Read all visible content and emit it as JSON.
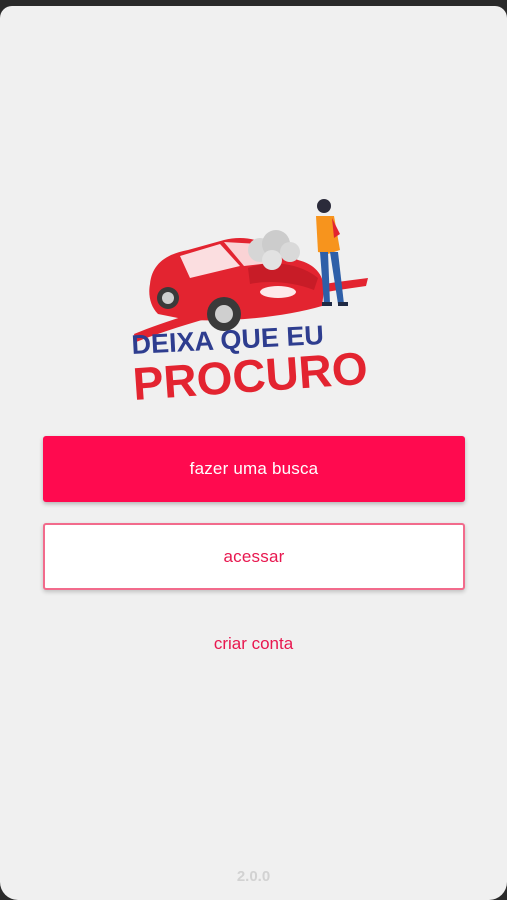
{
  "logo": {
    "line1": "DEIXA QUE EU",
    "line2": "PROCURO",
    "colors": {
      "red": "#e32430",
      "blue": "#2e3d8f"
    }
  },
  "actions": {
    "search_label": "fazer uma busca",
    "login_label": "acessar",
    "signup_label": "criar conta"
  },
  "footer": {
    "version": "2.0.0"
  },
  "colors": {
    "accent": "#ff0a4f",
    "background": "#f0f0f0"
  }
}
